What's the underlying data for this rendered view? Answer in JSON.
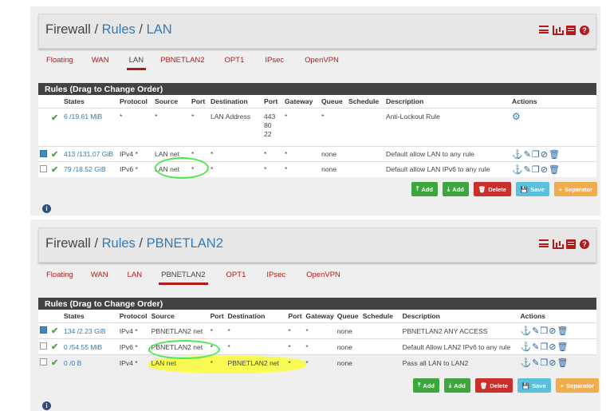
{
  "sections": [
    {
      "breadcrumb": {
        "root": "Firewall",
        "sep1": "/",
        "mid": "Rules",
        "sep2": "/",
        "leaf": "LAN"
      },
      "tabs": [
        "Floating",
        "WAN",
        "LAN",
        "PBNETLAN2",
        "OPT1",
        "IPsec",
        "OpenVPN"
      ],
      "active_tab": "LAN",
      "table_title": "Rules (Drag to Change Order)",
      "columns": [
        "States",
        "Protocol",
        "Source",
        "Port",
        "Destination",
        "Port",
        "Gateway",
        "Queue",
        "Schedule",
        "Description",
        "Actions"
      ],
      "rows": [
        {
          "states": "6 /19.61 MiB",
          "protocol": "*",
          "source": "*",
          "port": "*",
          "destination": "LAN Address",
          "dport": "443\n80\n22",
          "gateway": "*",
          "queue": "*",
          "schedule": "",
          "description": "Anti-Lockout Rule"
        },
        {
          "states": "413 /131.07 GiB",
          "protocol": "IPv4 *",
          "source": "LAN net",
          "port": "*",
          "destination": "*",
          "dport": "*",
          "gateway": "*",
          "queue": "none",
          "schedule": "",
          "description": "Default allow LAN to any rule"
        },
        {
          "states": "79 /18.52 GiB",
          "protocol": "IPv6 *",
          "source": "LAN net",
          "port": "*",
          "destination": "*",
          "dport": "*",
          "gateway": "*",
          "queue": "none",
          "schedule": "",
          "description": "Default allow LAN IPv6 to any rule"
        }
      ]
    },
    {
      "breadcrumb": {
        "root": "Firewall",
        "sep1": "/",
        "mid": "Rules",
        "sep2": "/",
        "leaf": "PBNETLAN2"
      },
      "tabs": [
        "Floating",
        "WAN",
        "LAN",
        "PBNETLAN2",
        "OPT1",
        "IPsec",
        "OpenVPN"
      ],
      "active_tab": "PBNETLAN2",
      "table_title": "Rules (Drag to Change Order)",
      "columns": [
        "States",
        "Protocol",
        "Source",
        "Port",
        "Destination",
        "Port",
        "Gateway",
        "Queue",
        "Schedule",
        "Description",
        "Actions"
      ],
      "rows": [
        {
          "states": "134 /2.23 GiB",
          "protocol": "IPv4 *",
          "source": "PBNETLAN2 net",
          "port": "*",
          "destination": "*",
          "dport": "*",
          "gateway": "*",
          "queue": "none",
          "schedule": "",
          "description": "PBNETLAN2 ANY ACCESS"
        },
        {
          "states": "0 /54.55 MiB",
          "protocol": "IPv6 *",
          "source": "PBNETLAN2 net",
          "port": "*",
          "destination": "*",
          "dport": "*",
          "gateway": "*",
          "queue": "none",
          "schedule": "",
          "description": "Default Allow LAN2 IPv6 to any rule"
        },
        {
          "states": "0 /0 B",
          "protocol": "IPv4 *",
          "source": "LAN net",
          "port": "*",
          "destination": "PBNETLAN2 net",
          "dport": "*",
          "gateway": "*",
          "queue": "none",
          "schedule": "",
          "description": "Pass all LAN to LAN2"
        }
      ]
    }
  ],
  "buttons": {
    "add1": "Add",
    "add2": "Add",
    "delete": "Delete",
    "save": "Save",
    "separator": "Separator"
  },
  "colors": {
    "accent": "#b31b1b",
    "link": "#337ab7",
    "check": "#4ca64c"
  }
}
